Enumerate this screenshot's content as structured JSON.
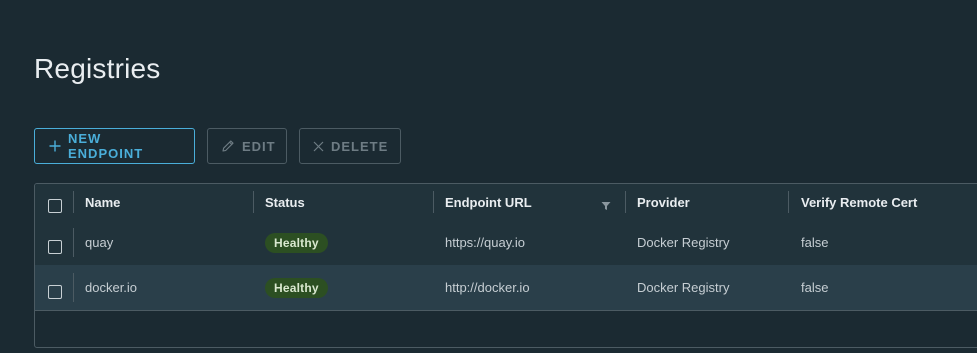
{
  "page": {
    "title": "Registries"
  },
  "toolbar": {
    "new_label": "NEW ENDPOINT",
    "edit_label": "EDIT",
    "delete_label": "DELETE"
  },
  "table": {
    "columns": [
      "Name",
      "Status",
      "Endpoint URL",
      "Provider",
      "Verify Remote Cert"
    ],
    "rows": [
      {
        "name": "quay",
        "status": "Healthy",
        "url": "https://quay.io",
        "provider": "Docker Registry",
        "verify": "false"
      },
      {
        "name": "docker.io",
        "status": "Healthy",
        "url": "http://docker.io",
        "provider": "Docker Registry",
        "verify": "false"
      }
    ]
  },
  "colors": {
    "background": "#1b2a32",
    "accent": "#4aaed9",
    "healthy_badge": "#2c4f22",
    "selected_row": "#2a3f4a"
  },
  "icons": {
    "new": "plus-icon",
    "edit": "pencil-icon",
    "delete": "x-icon",
    "filter": "filter-icon"
  }
}
